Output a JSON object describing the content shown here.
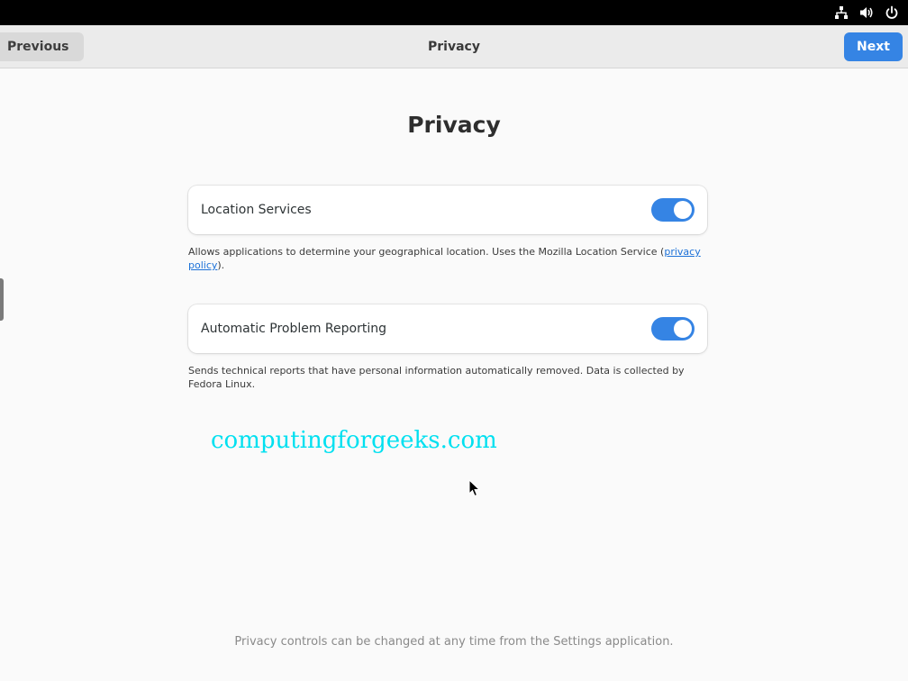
{
  "system_bar": {
    "icons": [
      "network-icon",
      "volume-icon",
      "power-icon"
    ]
  },
  "header": {
    "previous_label": "Previous",
    "title": "Privacy",
    "next_label": "Next"
  },
  "main": {
    "title": "Privacy",
    "location": {
      "label": "Location Services",
      "enabled": true,
      "desc_before": "Allows applications to determine your geographical location. Uses the Mozilla Location Service (",
      "link_text": "privacy policy",
      "desc_after": ")."
    },
    "reporting": {
      "label": "Automatic Problem Reporting",
      "enabled": true,
      "desc": "Sends technical reports that have personal information automatically removed. Data is collected by Fedora Linux."
    },
    "watermark": "computingforgeeks.com",
    "footer": "Privacy controls can be changed at any time from the Settings application."
  },
  "colors": {
    "accent": "#3584e4",
    "watermark": "#00e0f0"
  }
}
